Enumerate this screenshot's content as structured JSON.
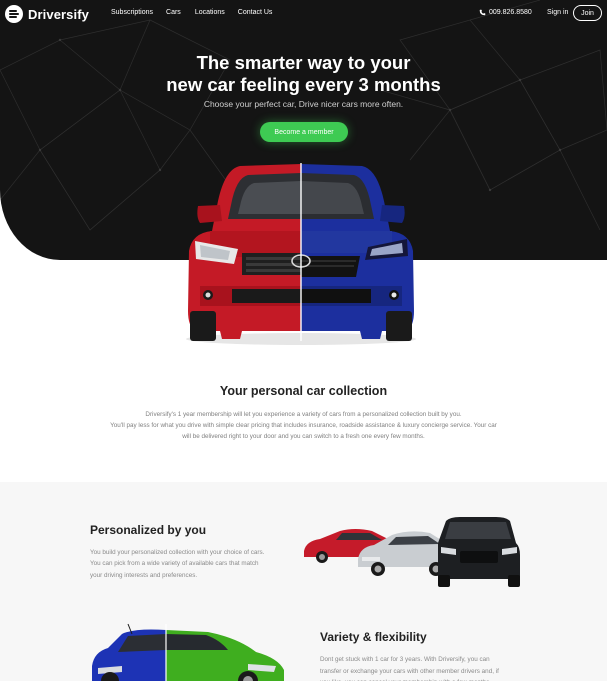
{
  "brand": {
    "name": "Driversify"
  },
  "nav": {
    "links": [
      "Subscriptions",
      "Cars",
      "Locations",
      "Contact Us"
    ],
    "phone": "009.826.8580",
    "signin": "Sign in",
    "join": "Join"
  },
  "hero": {
    "title_line1": "The smarter way to your",
    "title_line2": "new car feeling every 3 months",
    "subtitle": "Choose your perfect car, Drive nicer cars more often.",
    "cta": "Become a member"
  },
  "collection": {
    "title": "Your personal car collection",
    "line1": "Driversify's 1 year membership will let you experience a variety of cars from a personalized collection built by you.",
    "line2": "You'll pay less for what you drive with simple clear pricing that includes insurance, roadside assistance & luxury concierge service. Your car",
    "line3": "will be delivered right to your door and you can switch to a fresh one every few months."
  },
  "personalized": {
    "title": "Personalized by you",
    "text": "You build your personalized collection with your choice of cars. You can pick from a wide variety of available cars that match your driving interests and preferences."
  },
  "variety": {
    "title": "Variety & flexibility",
    "text": "Dont get stuck with 1 car for 3 years. With Driversify, you can transfer or exchange your cars with other member drivers and, if you like, you can cancel your membership with a few months"
  },
  "colors": {
    "accent": "#3ecb53",
    "hero_bg": "#141414",
    "section_bg": "#f7f7f7"
  },
  "icons": {
    "logo": "driversify-logo-icon",
    "phone": "phone-icon"
  }
}
